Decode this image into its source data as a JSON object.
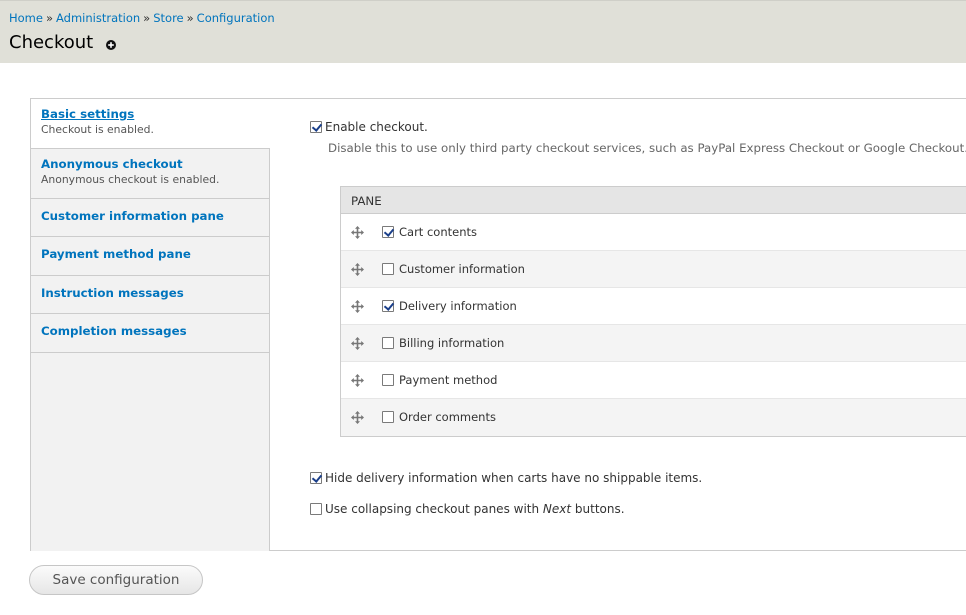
{
  "breadcrumb": [
    {
      "label": "Home"
    },
    {
      "label": "Administration"
    },
    {
      "label": "Store"
    },
    {
      "label": "Configuration"
    }
  ],
  "breadcrumb_separator": "»",
  "page_title": "Checkout",
  "shortcut_icon": "plus-circle-icon",
  "vertical_tabs": [
    {
      "title": "Basic settings",
      "summary": "Checkout is enabled.",
      "selected": true
    },
    {
      "title": "Anonymous checkout",
      "summary": "Anonymous checkout is enabled."
    },
    {
      "title": "Customer information pane"
    },
    {
      "title": "Payment method pane"
    },
    {
      "title": "Instruction messages"
    },
    {
      "title": "Completion messages"
    }
  ],
  "enable_checkout": {
    "label": "Enable checkout.",
    "checked": true,
    "description": "Disable this to use only third party checkout services, such as PayPal Express Checkout or Google Checkout."
  },
  "pane_table": {
    "header": "PANE",
    "drag_icon": "drag-handle-icon",
    "rows": [
      {
        "label": "Cart contents",
        "checked": true
      },
      {
        "label": "Customer information",
        "checked": false
      },
      {
        "label": "Delivery information",
        "checked": true
      },
      {
        "label": "Billing information",
        "checked": false
      },
      {
        "label": "Payment method",
        "checked": false
      },
      {
        "label": "Order comments",
        "checked": false
      }
    ]
  },
  "hide_delivery": {
    "label": "Hide delivery information when carts have no shippable items.",
    "checked": true
  },
  "collapsing_panes": {
    "label_before": "Use collapsing checkout panes with ",
    "label_em": "Next",
    "label_after": " buttons.",
    "checked": false
  },
  "save_button": {
    "label": "Save configuration"
  },
  "colors": {
    "link": "#0074bd",
    "header_bg": "#e0e0d8",
    "tab_bg": "#f2f2f2"
  }
}
